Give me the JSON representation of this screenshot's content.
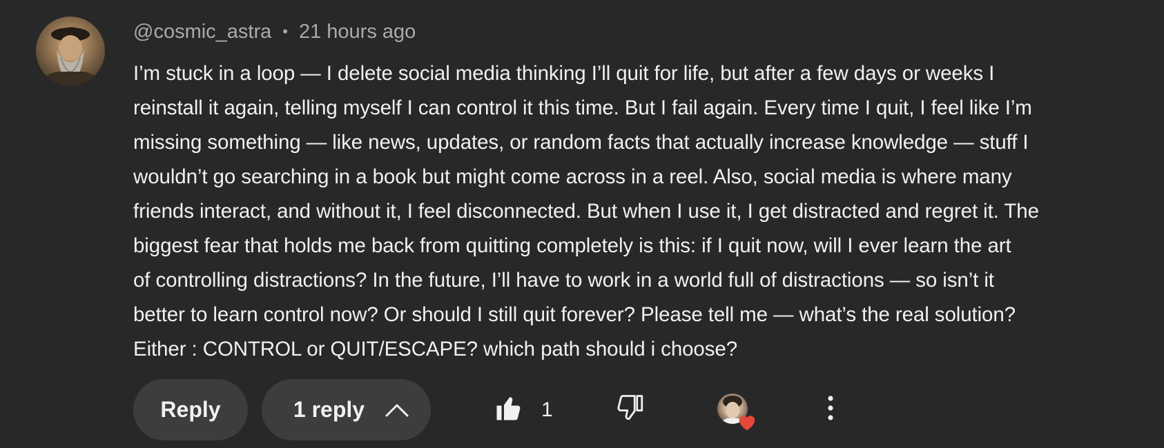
{
  "comment": {
    "author": "@cosmic_astra",
    "separator": "•",
    "timestamp": "21 hours ago",
    "text": "I’m stuck in a loop — I delete social media thinking I’ll quit for life, but after a few days or weeks I\nreinstall it again, telling myself I can control it this time. But I fail again. Every time I quit, I feel like I’m\nmissing something — like news, updates, or random facts that actually increase knowledge — stuff I\nwouldn’t go searching in a book but might come across in a reel. Also, social media is where many\nfriends interact, and without it, I feel disconnected. But when I use it, I get distracted and regret it. The\nbiggest fear that holds me back from quitting completely is this: if I quit now, will I ever learn the art\nof controlling distractions? In the future, I’ll have to work in a world full of distractions — so isn’t it\nbetter to learn control now? Or should I still quit forever? Please tell me — what’s the real solution?\nEither : CONTROL or  QUIT/ESCAPE? which path should i choose?"
  },
  "actions": {
    "reply_label": "Reply",
    "replies_label": "1 reply",
    "like_count": "1"
  },
  "icons": {
    "avatar": "user-avatar",
    "like": "thumbs-up-icon",
    "dislike": "thumbs-down-icon",
    "chevron": "chevron-up-icon",
    "creator_heart": "creator-heart-icon",
    "more": "more-vertical-icon"
  },
  "colors": {
    "background": "#282828",
    "text_primary": "#f1f1f1",
    "text_secondary": "#aaaaaa",
    "pill_bg": "#3d3d3d",
    "heart": "#e5483b"
  }
}
